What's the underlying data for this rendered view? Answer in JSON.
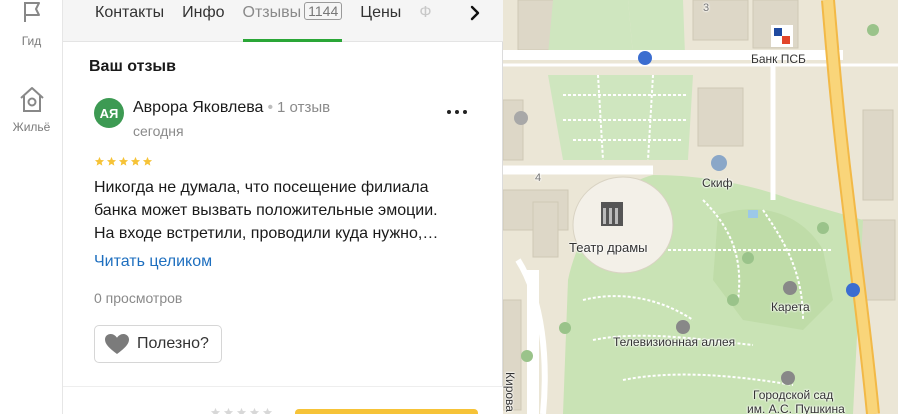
{
  "rail": {
    "items": [
      {
        "label": "Гид",
        "icon": "flag-icon"
      },
      {
        "label": "Жильё",
        "icon": "house-icon"
      }
    ]
  },
  "tabs": {
    "items": [
      {
        "label": "Контакты"
      },
      {
        "label": "Инфо"
      },
      {
        "label": "Отзывы",
        "count": "1144"
      },
      {
        "label": "Цены"
      },
      {
        "label": "Ф"
      }
    ],
    "active": "Отзывы",
    "next_icon": "chevron-right-icon"
  },
  "review": {
    "section_title": "Ваш отзыв",
    "avatar_initials": "АЯ",
    "avatar_color": "#3d9a53",
    "author": "Аврора Яковлева",
    "author_meta": "1 отзыв",
    "date": "сегодня",
    "rating": 5,
    "text_lines": [
      "Никогда не думала, что посещение филиала",
      "банка может вызвать положительные эмоции.",
      "На входе встретили, проводили куда нужно,…"
    ],
    "read_more": "Читать целиком",
    "views": "0 просмотров",
    "useful_label": "Полезно?"
  },
  "map": {
    "labels": {
      "bank": "Банк ПСБ",
      "theatre": "Театр драмы",
      "skif": "Скиф",
      "karета": "Карета",
      "alley": "Телевизионная аллея",
      "garden1": "Городской сад",
      "garden2": "им. А.С. Пушкина",
      "street": "Кирова",
      "house4": "4",
      "house3": "3"
    },
    "colors": {
      "park": "#c9e3b5",
      "road": "#ffffff",
      "highway": "#f7d26a",
      "building": "#dcd6c6",
      "accent": "#2aa637"
    }
  }
}
